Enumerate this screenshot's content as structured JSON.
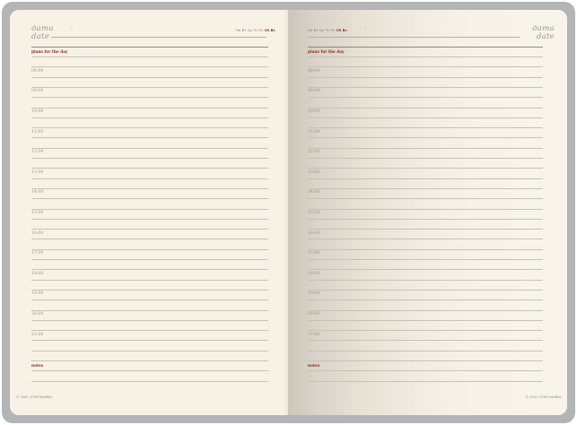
{
  "date_header": {
    "label_ru": "дата",
    "label_en": "date",
    "weekdays": [
      "Пн",
      "Вт",
      "Ср",
      "Чт",
      "Пт"
    ],
    "weekend": [
      "Сб",
      "Вс"
    ]
  },
  "plans_label": "plans for the day",
  "hours": [
    "08:00",
    "09:00",
    "10:00",
    "11:00",
    "12:00",
    "13:00",
    "14:00",
    "15:00",
    "16:00",
    "17:00",
    "18:00",
    "19:00",
    "20:00",
    "21:00"
  ],
  "notes_label": "notes",
  "copyright": "© ООО «ТОМ КАНВА»",
  "colors": {
    "cover": "#b3b4b6",
    "paper": "#f8f2e6",
    "accent": "#8b2a18",
    "rule": "#c9c1b4"
  }
}
